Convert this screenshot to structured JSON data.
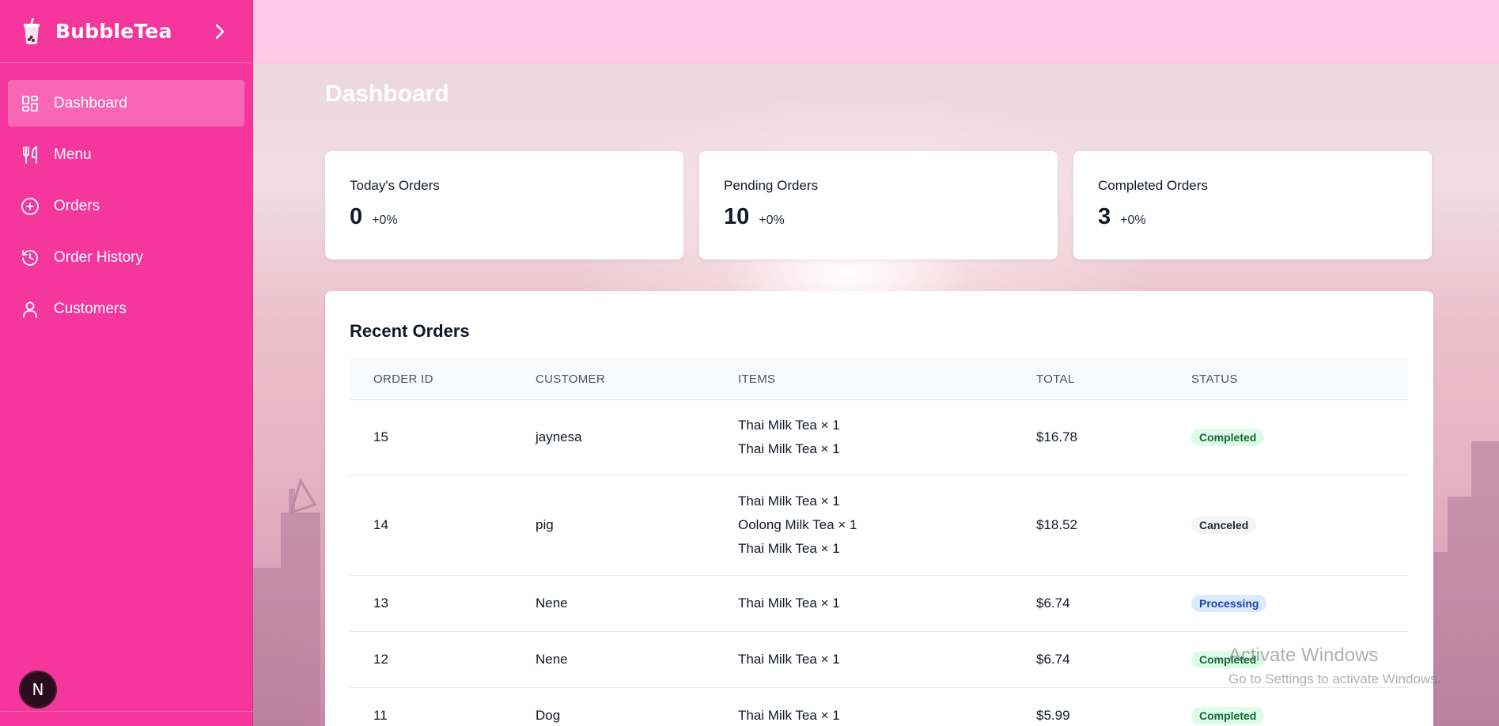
{
  "brand": {
    "title": "BubbleTea",
    "icon": "bubble-tea-cup-icon"
  },
  "sidebar": {
    "items": [
      {
        "label": "Dashboard",
        "icon": "dashboard-icon",
        "active": true
      },
      {
        "label": "Menu",
        "icon": "utensils-icon",
        "active": false
      },
      {
        "label": "Orders",
        "icon": "plus-circle-icon",
        "active": false
      },
      {
        "label": "Order History",
        "icon": "history-icon",
        "active": false
      },
      {
        "label": "Customers",
        "icon": "user-icon",
        "active": false
      }
    ],
    "avatar_letter": "N"
  },
  "page": {
    "title": "Dashboard"
  },
  "stats": [
    {
      "label": "Today's Orders",
      "value": "0",
      "change": "+0%"
    },
    {
      "label": "Pending Orders",
      "value": "10",
      "change": "+0%"
    },
    {
      "label": "Completed Orders",
      "value": "3",
      "change": "+0%"
    }
  ],
  "recent_orders": {
    "title": "Recent Orders",
    "columns": [
      "ORDER ID",
      "CUSTOMER",
      "ITEMS",
      "TOTAL",
      "STATUS"
    ],
    "rows": [
      {
        "id": "15",
        "customer": "jaynesa",
        "items": [
          "Thai Milk Tea × 1",
          "Thai Milk Tea × 1"
        ],
        "total": "$16.78",
        "status": "Completed"
      },
      {
        "id": "14",
        "customer": "pig",
        "items": [
          "Thai Milk Tea × 1",
          "Oolong Milk Tea × 1",
          "Thai Milk Tea × 1"
        ],
        "total": "$18.52",
        "status": "Canceled"
      },
      {
        "id": "13",
        "customer": "Nene",
        "items": [
          "Thai Milk Tea × 1"
        ],
        "total": "$6.74",
        "status": "Processing"
      },
      {
        "id": "12",
        "customer": "Nene",
        "items": [
          "Thai Milk Tea × 1"
        ],
        "total": "$6.74",
        "status": "Completed"
      },
      {
        "id": "11",
        "customer": "Dog",
        "items": [
          "Thai Milk Tea × 1"
        ],
        "total": "$5.99",
        "status": "Completed"
      }
    ]
  },
  "watermark": {
    "line1": "Activate Windows",
    "line2": "Go to Settings to activate Windows."
  },
  "colors": {
    "sidebar": "#f5369d",
    "sidebar_active": "#f866b5",
    "topbar": "#fcc9e6"
  }
}
